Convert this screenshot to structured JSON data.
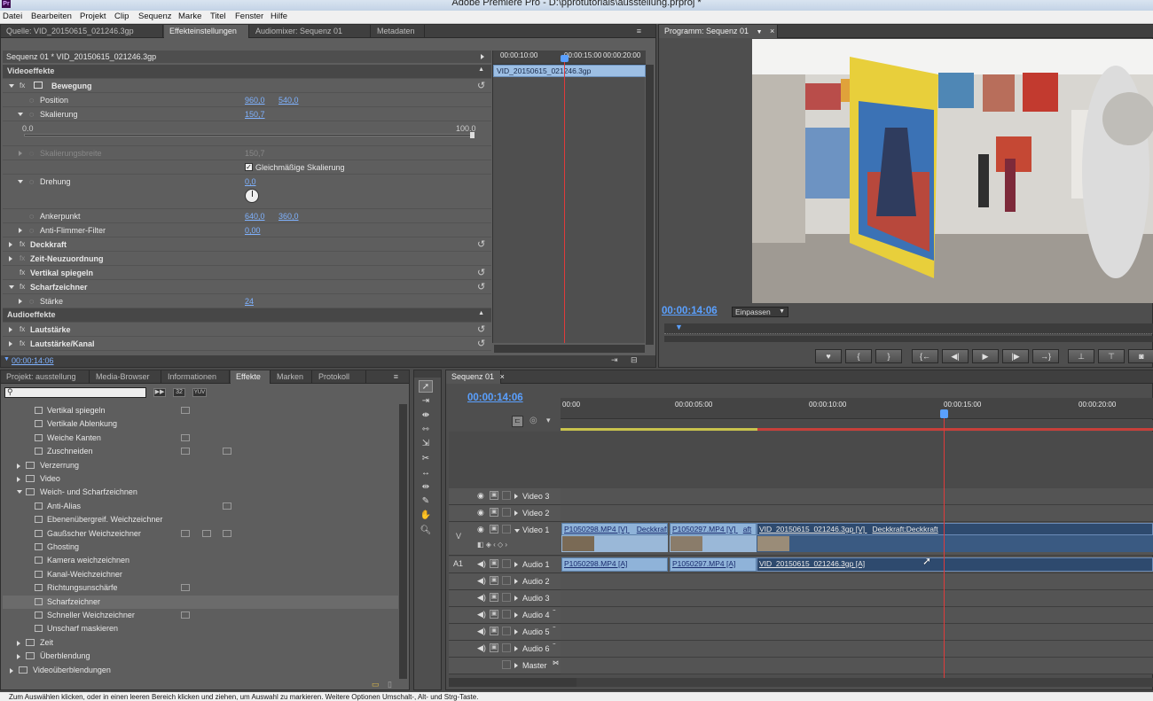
{
  "window": {
    "title": "Adobe Premiere Pro - D:\\pprotutorials\\ausstellung.prproj *",
    "logo": "Pr"
  },
  "menu": [
    "Datei",
    "Bearbeiten",
    "Projekt",
    "Clip",
    "Sequenz",
    "Marke",
    "Titel",
    "Fenster",
    "Hilfe"
  ],
  "source_tabs": [
    "Quelle: VID_20150615_021246.3gp",
    "Effekteinstellungen",
    "Audiomixer: Sequenz 01",
    "Metadaten"
  ],
  "effects": {
    "header": "Sequenz 01 * VID_20150615_021246.3gp",
    "timecodes": [
      "00:00:10:00",
      "00:00:15:00",
      "00:00:20:00"
    ],
    "clip_name": "VID_20150615_021246.3gp",
    "video_section": "Videoeffekte",
    "bewegung": "Bewegung",
    "position_label": "Position",
    "position_x": "960,0",
    "position_y": "540,0",
    "skalierung_label": "Skalierung",
    "skalierung_value": "150,7",
    "slider_min": "0.0",
    "slider_max": "100.0",
    "skalierungsbreite_label": "Skalierungsbreite",
    "skalierungsbreite_value": "150,7",
    "uniform_label": "Gleichmäßige Skalierung",
    "drehung_label": "Drehung",
    "drehung_value": "0,0",
    "anker_label": "Ankerpunkt",
    "anker_x": "640,0",
    "anker_y": "360,0",
    "flimmer_label": "Anti-Flimmer-Filter",
    "flimmer_value": "0,00",
    "deckkraft": "Deckkraft",
    "zeit": "Zeit-Neuzuordnung",
    "vspiegeln": "Vertikal spiegeln",
    "scharf": "Scharfzeichner",
    "staerke_label": "Stärke",
    "staerke_value": "24",
    "audio_section": "Audioeffekte",
    "lautstaerke": "Lautstärke",
    "lautstaerke_kanal": "Lautstärke/Kanal",
    "footer_time": "00:00:14:06"
  },
  "program": {
    "tab": "Programm: Sequenz 01",
    "timecode": "00:00:14:06",
    "fit": "Einpassen"
  },
  "project_tabs": [
    "Projekt: ausstellung",
    "Media-Browser",
    "Informationen",
    "Effekte",
    "Marken",
    "Protokoll"
  ],
  "effects_list": [
    {
      "label": "Vertikal spiegeln",
      "type": "item"
    },
    {
      "label": "Vertikale Ablenkung",
      "type": "item"
    },
    {
      "label": "Weiche Kanten",
      "type": "item"
    },
    {
      "label": "Zuschneiden",
      "type": "item"
    },
    {
      "label": "Verzerrung",
      "type": "folder"
    },
    {
      "label": "Video",
      "type": "folder"
    },
    {
      "label": "Weich- und Scharfzeichnen",
      "type": "folder-open"
    },
    {
      "label": "Anti-Alias",
      "type": "item"
    },
    {
      "label": "Ebenenübergreif. Weichzeichner",
      "type": "item"
    },
    {
      "label": "Gaußscher Weichzeichner",
      "type": "item"
    },
    {
      "label": "Ghosting",
      "type": "item"
    },
    {
      "label": "Kamera weichzeichnen",
      "type": "item"
    },
    {
      "label": "Kanal-Weichzeichner",
      "type": "item"
    },
    {
      "label": "Richtungsunschärfe",
      "type": "item"
    },
    {
      "label": "Scharfzeichner",
      "type": "item"
    },
    {
      "label": "Schneller Weichzeichner",
      "type": "item"
    },
    {
      "label": "Unscharf maskieren",
      "type": "item"
    },
    {
      "label": "Zeit",
      "type": "folder"
    },
    {
      "label": "Überblendung",
      "type": "folder"
    },
    {
      "label": "Videoüberblendungen",
      "type": "folder-root"
    }
  ],
  "search_badges": [
    "32",
    "YUV"
  ],
  "timeline": {
    "tab": "Sequenz 01",
    "timecode": "00:00:14:06",
    "ruler": [
      "00:00",
      "00:00:05:00",
      "00:00:10:00",
      "00:00:15:00",
      "00:00:20:00"
    ],
    "tracks": [
      "Video 3",
      "Video 2",
      "Video 1",
      "Audio 1",
      "Audio 2",
      "Audio 3",
      "Audio 4",
      "Audio 5",
      "Audio 6",
      "Master"
    ],
    "v_label": "V",
    "a_label": "A1",
    "clips_v": [
      "P1050298.MP4 [V]",
      "Deckkraft",
      "P1050297.MP4 [V]",
      "aft",
      "VID_20150615_021246.3gp [V]",
      "Deckkraft:Deckkraft"
    ],
    "clips_a": [
      "P1050298.MP4 [A]",
      "P1050297.MP4 [A]",
      "VID_20150615_021246.3gp [A]"
    ]
  },
  "status": "Zum Auswählen klicken, oder in einen leeren Bereich klicken und ziehen, um Auswahl zu markieren. Weitere Optionen Umschalt-, Alt- und Strg-Taste."
}
